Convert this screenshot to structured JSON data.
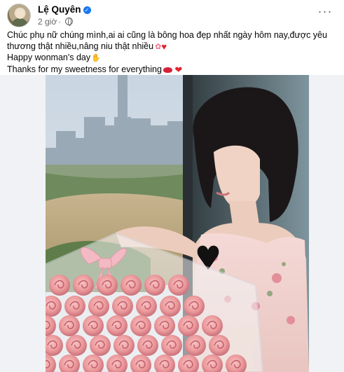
{
  "post": {
    "author": "Lệ Quyên",
    "time": "2 giờ",
    "more_label": "···",
    "caption": {
      "line1": "Chúc phụ nữ chúng mình,ai ai cũng là bông hoa đẹp nhất ngày hôm nay,được yêu thương thật nhiều,nâng niu thật nhiều",
      "line2": "Happy wonman's day",
      "line3": "Thanks for my sweetness for everything"
    }
  },
  "icons": {
    "verified": "verified-badge-icon",
    "globe": "globe-icon",
    "flower": "flower-emoji-icon",
    "hearts": "two-hearts-emoji-icon",
    "hand": "hand-emoji-icon",
    "lips": "lips-emoji-icon",
    "heart": "red-heart-emoji-icon"
  },
  "colors": {
    "accent": "#1877f2",
    "meta_text": "#65676b",
    "photo_bg": "#f0f2f5"
  }
}
